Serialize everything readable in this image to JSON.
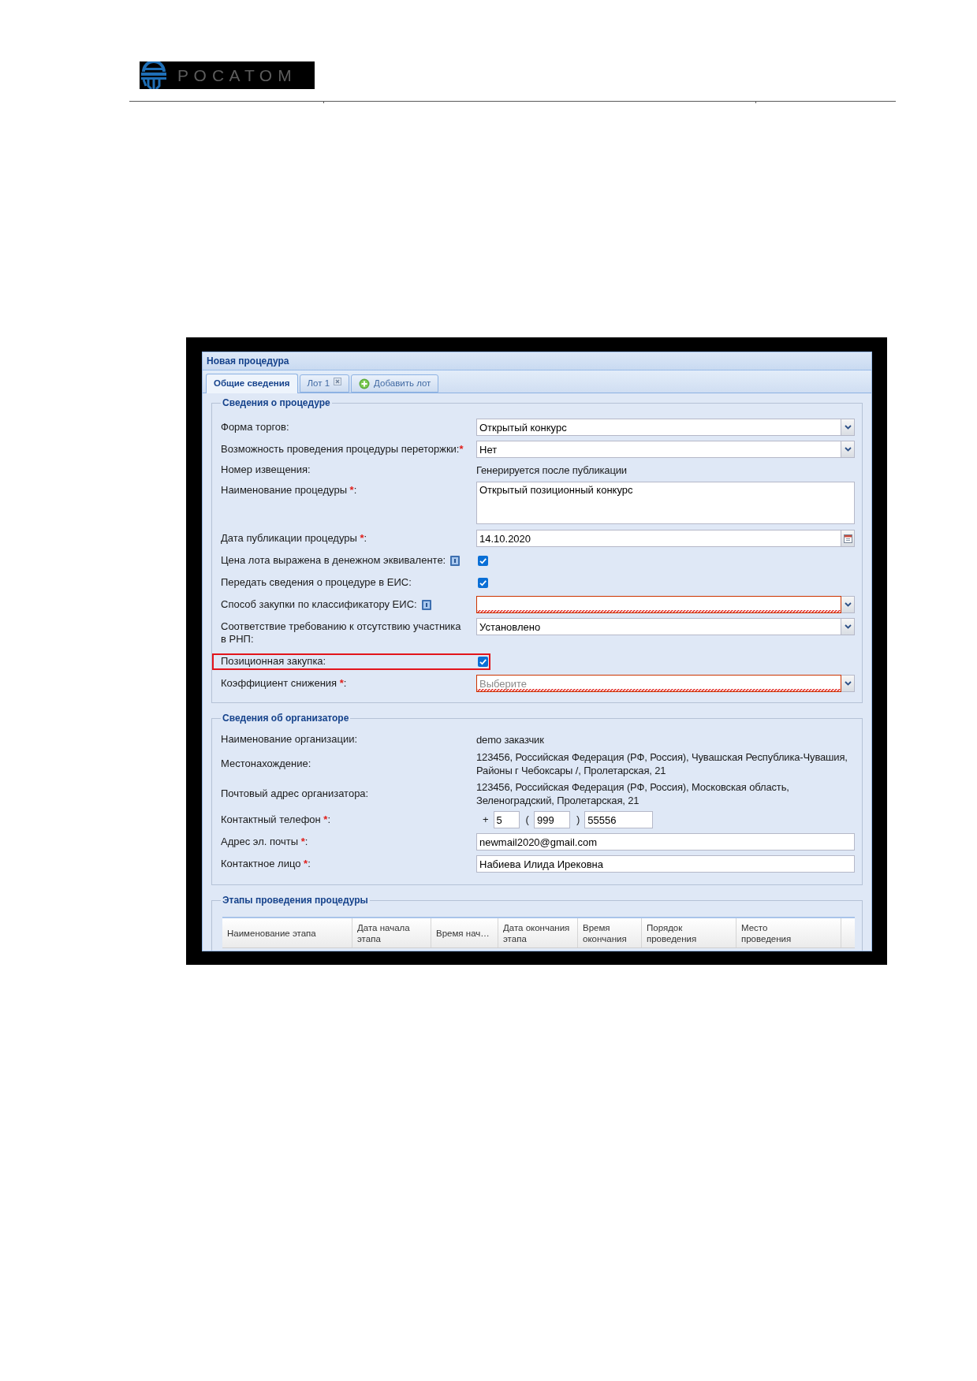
{
  "header": {
    "logo_text": "РОСАТОМ"
  },
  "window": {
    "title": "Новая процедура"
  },
  "tabs": [
    {
      "kind": "tab",
      "label": "Общие сведения",
      "selected": true,
      "closable": false
    },
    {
      "kind": "tab",
      "label": "Лот 1",
      "selected": false,
      "closable": true
    },
    {
      "kind": "add",
      "label": "Добавить лот",
      "selected": false,
      "closable": false
    }
  ],
  "sections": [
    {
      "title": "Сведения о процедуре",
      "fields": [
        {
          "kind": "select",
          "label": "Форма торгов:",
          "value": "Открытый конкурс",
          "invalid": false,
          "help": false,
          "highlighted": false
        },
        {
          "kind": "select",
          "label": "Возможность проведения процедуры переторжки:",
          "required_mark": "*",
          "value": "Нет",
          "invalid": false,
          "help": false,
          "highlighted": false
        },
        {
          "kind": "text",
          "label": "Номер извещения:",
          "value": "Генерируется после публикации",
          "help": false,
          "highlighted": false
        },
        {
          "kind": "textarea",
          "label": "Наименование процедуры ",
          "required_mark": "*",
          "label_tail": ":",
          "value": "Открытый позиционный конкурс",
          "help": false,
          "highlighted": false
        },
        {
          "kind": "date",
          "label": "Дата публикации процедуры ",
          "required_mark": "*",
          "label_tail": ":",
          "value": "14.10.2020",
          "help": false,
          "highlighted": false
        },
        {
          "kind": "checkbox",
          "label": "Цена лота выражена в денежном эквиваленте:",
          "checked": true,
          "help": true,
          "highlighted": false
        },
        {
          "kind": "checkbox",
          "label": "Передать сведения о процедуре в ЕИС:",
          "checked": true,
          "help": false,
          "highlighted": false
        },
        {
          "kind": "select",
          "label": "Способ закупки по классификатору ЕИС:",
          "invalid": true,
          "help": true,
          "highlighted": false
        },
        {
          "kind": "select",
          "label": "Соответствие требованию к отсутствию участника в РНП:",
          "value": "Установлено",
          "invalid": false,
          "help": false,
          "highlighted": false
        },
        {
          "kind": "checkbox",
          "label": "Позиционная закупка:",
          "checked": true,
          "help": false,
          "highlighted": true
        },
        {
          "kind": "select",
          "label": "Коэффициент снижения ",
          "required_mark": "*",
          "label_tail": ":",
          "placeholder": "Выберите",
          "invalid": true,
          "help": false,
          "highlighted": false
        }
      ]
    },
    {
      "title": "Сведения об организаторе",
      "fields": [
        {
          "kind": "text",
          "label": "Наименование организации:",
          "value": "demo заказчик",
          "help": false,
          "highlighted": false
        },
        {
          "kind": "text",
          "label": "Местонахождение:",
          "value": "123456, Российская Федерация (РФ, Россия), Чувашская Республика-Чувашия, Районы г Чебоксары /, Пролетарская, 21",
          "help": false,
          "highlighted": false
        },
        {
          "kind": "text",
          "label": "Почтовый адрес организатора:",
          "value": "123456, Российская Федерация (РФ, Россия), Московская область, Зеленоградский, Пролетарская, 21",
          "help": false,
          "highlighted": false
        },
        {
          "kind": "phone",
          "label": "Контактный телефон ",
          "required_mark": "*",
          "label_tail": ":",
          "parts": [
            {
              "prefix": "+",
              "value": "5"
            },
            {
              "prefix": "(",
              "value": "999"
            },
            {
              "prefix": ")",
              "value": "55556"
            }
          ],
          "help": false,
          "highlighted": false
        },
        {
          "kind": "input",
          "label": "Адрес эл. почты ",
          "required_mark": "*",
          "label_tail": ":",
          "value": "newmail2020@gmail.com",
          "invalid": false,
          "help": false,
          "highlighted": false
        },
        {
          "kind": "input",
          "label": "Контактное лицо ",
          "required_mark": "*",
          "label_tail": ":",
          "value": "Набиева Илида Ирековна",
          "invalid": false,
          "help": false,
          "highlighted": false
        }
      ]
    }
  ],
  "stages": {
    "title": "Этапы проведения процедуры",
    "table": {
      "columns": [
        "Наименование этапа",
        "Дата начала этапа",
        "Время нач…",
        "Дата окончания этапа",
        "Время окончания",
        "Порядок проведения",
        "Место проведения"
      ]
    }
  }
}
